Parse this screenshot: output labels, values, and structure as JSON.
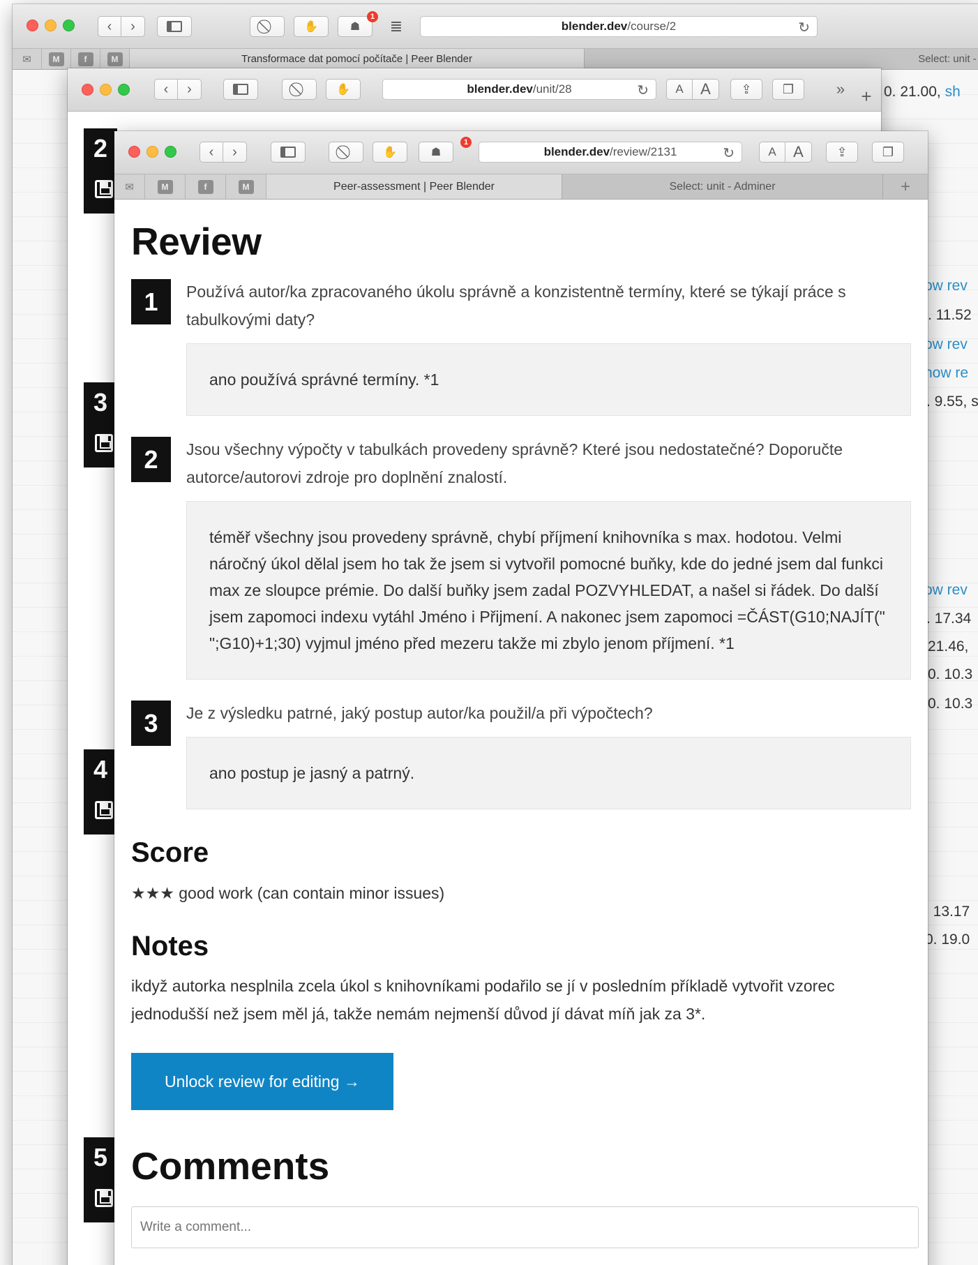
{
  "window_back1": {
    "url_domain": "blender.dev",
    "url_path": "/course/2",
    "tab_active": "Transformace dat pomocí počítače | Peer Blender",
    "tab_other": "Select: unit - A",
    "notification_count": "1"
  },
  "window_back2": {
    "url_domain": "blender.dev",
    "url_path": "/unit/28",
    "text_size_small": "A",
    "text_size_large": "A",
    "overflow": "»",
    "side_snippet_value": "0. 21.00, ",
    "side_snippet_link": "sh",
    "blocks": [
      "2",
      "3",
      "4",
      "5"
    ]
  },
  "side_snippets": [
    {
      "text": "ow rev",
      "link": true
    },
    {
      "text": ". 11.52",
      "link": false
    },
    {
      "text": "ow rev",
      "link": true
    },
    {
      "text": "how re",
      "link": true
    },
    {
      "text": ". 9.55, s",
      "link": false
    },
    {
      "text": "ow rev",
      "link": true
    },
    {
      "text": ". 17.34",
      "link": false
    },
    {
      "text": "21.46,",
      "link": false
    },
    {
      "text": "0. 10.3",
      "link": false
    },
    {
      "text": "0. 10.3",
      "link": false
    },
    {
      "text": ". 13.17",
      "link": false
    },
    {
      "text": "0. 19.0",
      "link": false
    }
  ],
  "window_front": {
    "url_domain": "blender.dev",
    "url_path": "/review/2131",
    "text_size_small": "A",
    "text_size_large": "A",
    "notification_count": "1",
    "tab_active": "Peer-assessment | Peer Blender",
    "tab_other": "Select: unit - Adminer"
  },
  "review": {
    "title": "Review",
    "questions": [
      {
        "number": "1",
        "text": "Používá autor/ka zpracovaného úkolu správně a konzistentně termíny, které se týkají práce s tabulkovými daty?",
        "answer": "ano používá správné termíny. *1"
      },
      {
        "number": "2",
        "text": "Jsou všechny výpočty v tabulkách provedeny správně? Které jsou nedostatečné? Doporučte autorce/autorovi zdroje pro doplnění znalostí.",
        "answer": "téměř všechny jsou provedeny správně, chybí příjmení knihovníka s max. hodotou. Velmi náročný úkol dělal jsem ho tak že jsem si vytvořil pomocné buňky, kde do jedné jsem dal funkci max ze sloupce prémie. Do další buňky jsem zadal POZVYHLEDAT, a našel si řádek. Do další jsem zapomoci indexu vytáhl Jméno i Přijmení. A nakonec jsem zapomoci =ČÁST(G10;NAJÍT(\" \";G10)+1;30) vyjmul jméno před mezeru takže mi zbylo jenom příjmení. *1"
      },
      {
        "number": "3",
        "text": "Je z výsledku patrné, jaký postup autor/ka použil/a při výpočtech?",
        "answer": "ano postup je jasný a patrný."
      }
    ],
    "score_heading": "Score",
    "score_text": "★★★ good work (can contain minor issues)",
    "notes_heading": "Notes",
    "notes_text": "ikdyž autorka nesplnila zcela úkol s knihovníkami podařilo se jí v posledním příkladě vytvořit vzorec jednodušší než jsem měl já, takže nemám nejmenší důvod jí dávat míň jak za 3*.",
    "unlock_button": "Unlock review for editing →"
  },
  "comments": {
    "title": "Comments",
    "placeholder": "Write a comment..."
  },
  "colors": {
    "accent": "#0f85c6",
    "link": "#2a8ec9",
    "badge": "#ef3b2e"
  }
}
